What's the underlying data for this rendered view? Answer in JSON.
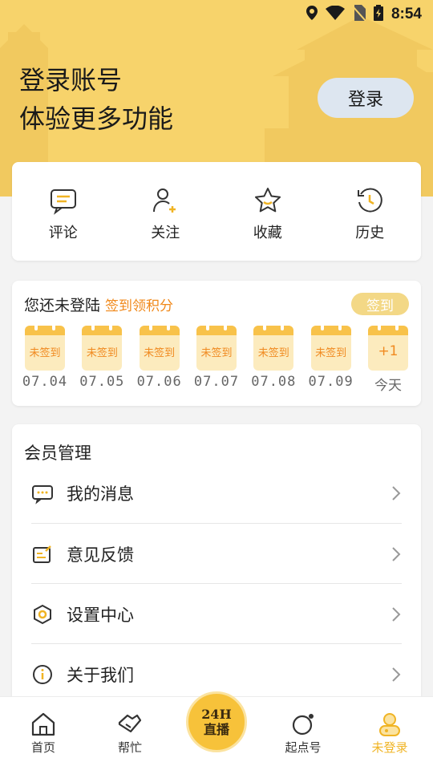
{
  "status_bar": {
    "time": "8:54",
    "icons": [
      "location-icon",
      "wifi-icon",
      "no-sim-icon",
      "battery-charging-icon"
    ]
  },
  "header": {
    "line1": "登录账号",
    "line2": "体验更多功能",
    "login_button": "登录",
    "background_color": "#f7d36b"
  },
  "quick_actions": [
    {
      "label": "评论",
      "icon": "comment-icon"
    },
    {
      "label": "关注",
      "icon": "follow-user-icon"
    },
    {
      "label": "收藏",
      "icon": "star-icon"
    },
    {
      "label": "历史",
      "icon": "history-icon"
    }
  ],
  "checkin": {
    "title": "您还未登陆",
    "subtitle": "签到领积分",
    "button": "签到",
    "days": [
      {
        "status": "未签到",
        "date": "07.04"
      },
      {
        "status": "未签到",
        "date": "07.05"
      },
      {
        "status": "未签到",
        "date": "07.06"
      },
      {
        "status": "未签到",
        "date": "07.07"
      },
      {
        "status": "未签到",
        "date": "07.08"
      },
      {
        "status": "未签到",
        "date": "07.09"
      },
      {
        "status": "+1",
        "date": "今天"
      }
    ]
  },
  "member": {
    "title": "会员管理",
    "items": [
      {
        "label": "我的消息",
        "icon": "message-icon"
      },
      {
        "label": "意见反馈",
        "icon": "feedback-icon"
      },
      {
        "label": "设置中心",
        "icon": "settings-icon"
      },
      {
        "label": "关于我们",
        "icon": "info-icon"
      }
    ]
  },
  "bottom_nav": {
    "items": [
      {
        "label": "首页",
        "icon": "home-icon"
      },
      {
        "label": "帮忙",
        "icon": "handshake-icon"
      },
      {
        "label": "起点号",
        "icon": "qidian-icon"
      },
      {
        "label": "未登录",
        "icon": "user-avatar-icon",
        "active": true
      }
    ],
    "live_button": {
      "line1": "24H",
      "line2": "直播"
    }
  },
  "colors": {
    "accent": "#f0b424",
    "orange_text": "#f0881a",
    "checkin_button": "#f3d886"
  }
}
